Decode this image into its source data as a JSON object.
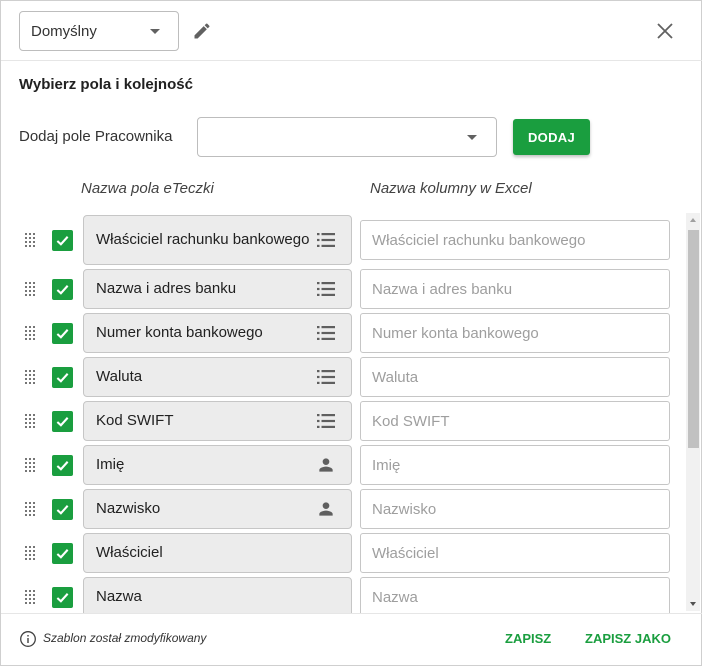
{
  "header": {
    "template_value": "Domyślny",
    "edit_icon": "pencil-icon",
    "close_icon": "close-icon"
  },
  "section_title": "Wybierz pola i kolejność",
  "add_field": {
    "label": "Dodaj pole Pracownika",
    "value": "",
    "button_label": "DODAJ"
  },
  "columns": {
    "field_header": "Nazwa pola eTeczki",
    "excel_header": "Nazwa kolumny w Excel"
  },
  "rows": [
    {
      "field": "Właściciel rachunku bankowego",
      "excel_placeholder": "Właściciel rachunku bankowego",
      "icon": "list-icon",
      "checked": true
    },
    {
      "field": "Nazwa i adres banku",
      "excel_placeholder": "Nazwa i adres banku",
      "icon": "list-icon",
      "checked": true
    },
    {
      "field": "Numer konta bankowego",
      "excel_placeholder": "Numer konta bankowego",
      "icon": "list-icon",
      "checked": true
    },
    {
      "field": "Waluta",
      "excel_placeholder": "Waluta",
      "icon": "list-icon",
      "checked": true
    },
    {
      "field": "Kod SWIFT",
      "excel_placeholder": "Kod SWIFT",
      "icon": "list-icon",
      "checked": true
    },
    {
      "field": "Imię",
      "excel_placeholder": "Imię",
      "icon": "person-icon",
      "checked": true
    },
    {
      "field": "Nazwisko",
      "excel_placeholder": "Nazwisko",
      "icon": "person-icon",
      "checked": true
    },
    {
      "field": "Właściciel",
      "excel_placeholder": "Właściciel",
      "icon": "",
      "checked": true
    },
    {
      "field": "Nazwa",
      "excel_placeholder": "Nazwa",
      "icon": "",
      "checked": true
    }
  ],
  "footer": {
    "status": "Szablon został zmodyfikowany",
    "save_label": "ZAPISZ",
    "save_as_label": "ZAPISZ JAKO"
  },
  "colors": {
    "accent": "#1a9e3f",
    "field_bg": "#ececec"
  }
}
